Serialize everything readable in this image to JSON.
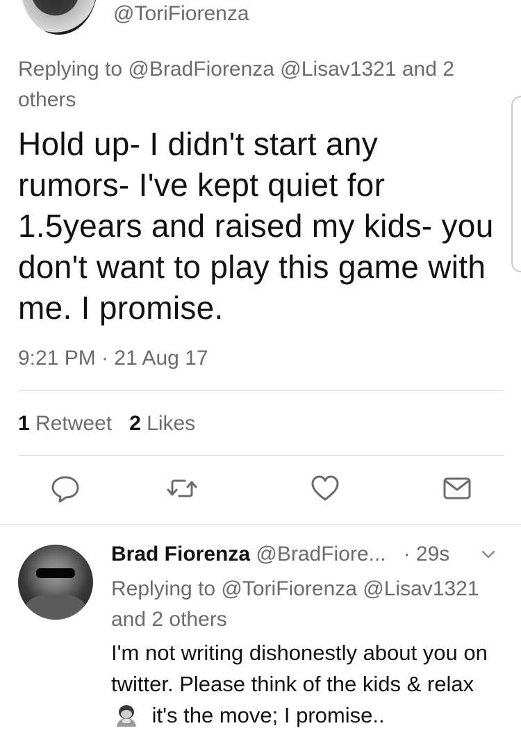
{
  "main_tweet": {
    "handle": "@ToriFiorenza",
    "replying_to": "Replying to @BradFiorenza @Lisav1321 and 2 others",
    "text": "Hold up- I didn't start any rumors- I've kept quiet for 1.5years and raised my kids- you don't want to play this game with me. I promise.",
    "timestamp": "9:21 PM · 21 Aug 17",
    "retweet_count": "1",
    "retweet_label": "Retweet",
    "like_count": "2",
    "like_label": "Likes"
  },
  "actions": {
    "reply_icon": "reply-bubble-icon",
    "retweet_icon": "retweet-icon",
    "like_icon": "heart-icon",
    "dm_icon": "envelope-icon"
  },
  "reply_tweet": {
    "name": "Brad Fiorenza",
    "handle": "@BradFiore...",
    "time": "· 29s",
    "replying_to": "Replying to @ToriFiorenza @Lisav1321 and 2 others",
    "text_part1": "I'm not writing dishonestly about you on twitter. Please think of the kids & relax",
    "emoji": "person-bowing-emoji",
    "text_part2": "it's the move; I promise.."
  },
  "colors": {
    "text": "#111111",
    "secondary_text": "#6b6b6b",
    "divider": "#dcdcdc",
    "background": "#ffffff"
  }
}
